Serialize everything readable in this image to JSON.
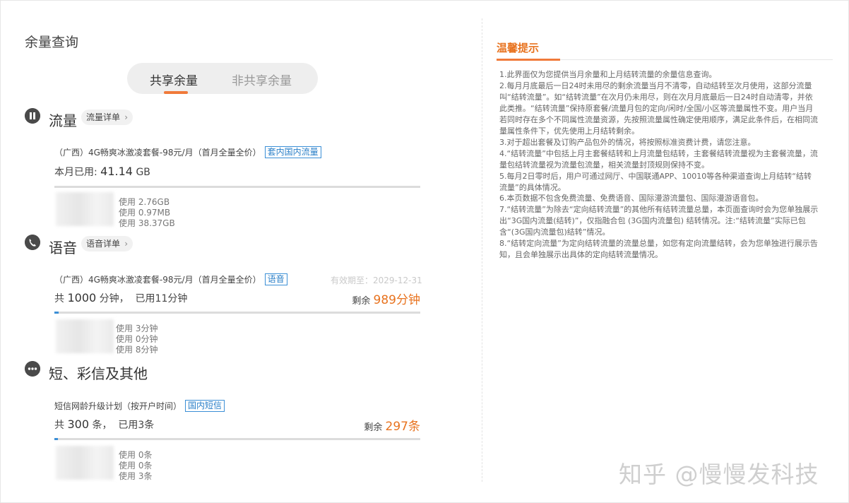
{
  "page": {
    "title": "余量查询"
  },
  "tabs": [
    {
      "label": "共享余量",
      "active": true
    },
    {
      "label": "非共享余量",
      "active": false
    }
  ],
  "colors": {
    "accent": "#f07a3a",
    "remain": "#e8731f",
    "tag": "#2a7fc8",
    "bar": "#3b8fd6"
  },
  "data_section": {
    "icon": "pause-icon",
    "title": "流量",
    "detail_button": "流量详单",
    "package": "（广西）4G畅爽冰激凌套餐-98元/月（首月全量全价）",
    "tag": "套内国内流量",
    "used_label": "本月已用:",
    "used_value": "41.14",
    "used_unit": "GB",
    "progress": 0,
    "lines": [
      "使用 2.76GB",
      "使用 0.97MB",
      "使用 38.37GB"
    ]
  },
  "voice_section": {
    "icon": "phone-icon",
    "title": "语音",
    "detail_button": "语音详单",
    "package": "（广西）4G畅爽冰激凌套餐-98元/月（首月全量全价）",
    "tag": "语音",
    "expire": "有效期至：2029-12-31",
    "total_prefix": "共",
    "total_value": "1000",
    "total_suffix": "分钟，",
    "used": "已用11分钟",
    "remain_label": "剩余",
    "remain_value": "989分钟",
    "progress": 0.011,
    "lines": [
      "使用 3分钟",
      "使用 0分钟",
      "使用 8分钟"
    ]
  },
  "sms_section": {
    "icon": "more-icon",
    "title": "短、彩信及其他",
    "package": "短信网龄升级计划（按开户时间）",
    "tag": "国内短信",
    "total_prefix": "共",
    "total_value": "300",
    "total_suffix": "条，",
    "used": "已用3条",
    "remain_label": "剩余",
    "remain_value": "297条",
    "progress": 0.01,
    "lines": [
      "使用 0条",
      "使用 0条",
      "使用 3条"
    ]
  },
  "tips": {
    "title": "温馨提示",
    "items": [
      "1.此界面仅为您提供当月余量和上月结转流量的余量信息查询。",
      "2.每月月底最后一日24时未用尽的剩余流量当月不清零，自动结转至次月使用，这部分流量叫“结转流量”。如“结转流量”在次月仍未用尽，则在次月月底最后一日24时自动清零，并依此类推。“结转流量”保持原套餐/流量月包的定向/闲时/全国/小区等流量属性不变。用户当月若同时存在多个不同属性流量资源，先按照流量属性确定使用顺序，满足此条件后，在相同流量属性条件下，优先使用上月结转剩余。",
      "3.对于超出套餐及订购产品包外的情况，将按照标准资费计费，请您注意。",
      "4.“结转流量”中包括上月主套餐结转和上月流量包结转，主套餐结转流量视为主套餐流量，流量包结转流量视为流量包流量，相关流量封顶规则保持不变。",
      "5.每月2日零时后，用户可通过网厅、中国联通APP、10010等各种渠道查询上月结转“结转流量”的具体情况。",
      "6.本页数据不包含免费流量、免费语音、国际漫游流量包、国际漫游语音包。",
      "7.“结转流量”为除去“定向结转流量”的其他所有结转流量总量，本页面查询时会为您单独展示出“3G国内流量(结转)”，仅指融合包 (3G国内流量包) 结转情况。注:“结转流量”实际已包含“(3G国内流量包)结转”情况。",
      "8.“结转定向流量”为定向结转流量的流量总量，如您有定向流量结转，会为您单独进行展示告知，且会单独展示出具体的定向结转流量情况。"
    ]
  },
  "watermark": "知乎 @慢慢发科技"
}
